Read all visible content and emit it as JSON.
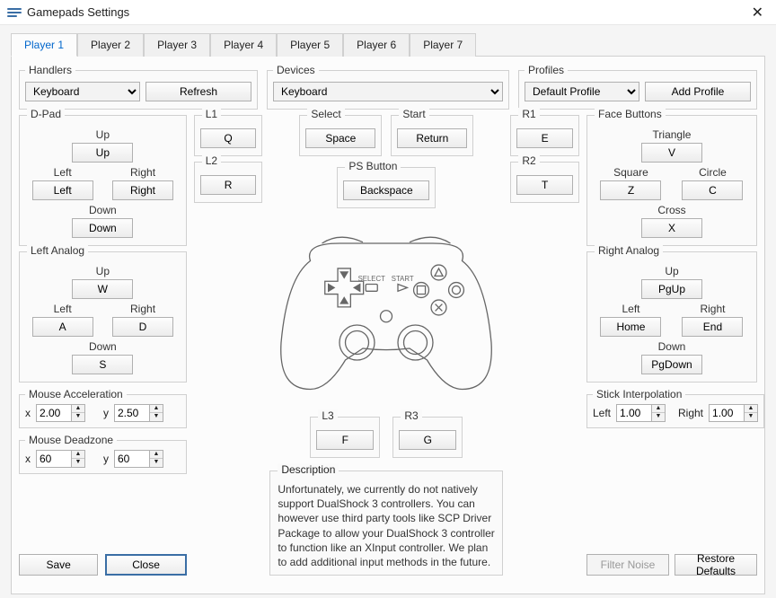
{
  "window": {
    "title": "Gamepads Settings"
  },
  "tabs": [
    "Player 1",
    "Player 2",
    "Player 3",
    "Player 4",
    "Player 5",
    "Player 6",
    "Player 7"
  ],
  "active_tab": 0,
  "handlers": {
    "legend": "Handlers",
    "selected": "Keyboard",
    "refresh": "Refresh"
  },
  "devices": {
    "legend": "Devices",
    "selected": "Keyboard"
  },
  "profiles": {
    "legend": "Profiles",
    "selected": "Default Profile",
    "add": "Add Profile"
  },
  "dpad": {
    "legend": "D-Pad",
    "up_lbl": "Up",
    "up": "Up",
    "left_lbl": "Left",
    "left": "Left",
    "right_lbl": "Right",
    "right": "Right",
    "down_lbl": "Down",
    "down": "Down"
  },
  "lanalog": {
    "legend": "Left Analog",
    "up_lbl": "Up",
    "up": "W",
    "left_lbl": "Left",
    "left": "A",
    "right_lbl": "Right",
    "right": "D",
    "down_lbl": "Down",
    "down": "S"
  },
  "ranalog": {
    "legend": "Right Analog",
    "up_lbl": "Up",
    "up": "PgUp",
    "left_lbl": "Left",
    "left": "Home",
    "right_lbl": "Right",
    "right": "End",
    "down_lbl": "Down",
    "down": "PgDown"
  },
  "l1": {
    "legend": "L1",
    "val": "Q"
  },
  "l2": {
    "legend": "L2",
    "val": "R"
  },
  "r1": {
    "legend": "R1",
    "val": "E"
  },
  "r2": {
    "legend": "R2",
    "val": "T"
  },
  "select": {
    "legend": "Select",
    "val": "Space"
  },
  "start": {
    "legend": "Start",
    "val": "Return"
  },
  "ps": {
    "legend": "PS Button",
    "val": "Backspace"
  },
  "l3": {
    "legend": "L3",
    "val": "F"
  },
  "r3": {
    "legend": "R3",
    "val": "G"
  },
  "face": {
    "legend": "Face Buttons",
    "tri_lbl": "Triangle",
    "tri": "V",
    "sq_lbl": "Square",
    "sq": "Z",
    "ci_lbl": "Circle",
    "ci": "C",
    "cr_lbl": "Cross",
    "cr": "X"
  },
  "maccel": {
    "legend": "Mouse Acceleration",
    "x_lbl": "x",
    "x": "2.00",
    "y_lbl": "y",
    "y": "2.50"
  },
  "mdead": {
    "legend": "Mouse Deadzone",
    "x_lbl": "x",
    "x": "60",
    "y_lbl": "y",
    "y": "60"
  },
  "interp": {
    "legend": "Stick Interpolation",
    "left_lbl": "Left",
    "left": "1.00",
    "right_lbl": "Right",
    "right": "1.00"
  },
  "desc_legend": "Description",
  "desc": "Unfortunately, we currently do not natively support DualShock 3 controllers. You can however use third party tools like SCP Driver Package to allow your DualShock 3 controller to function like an XInput controller. We plan to add additional input methods in the future.",
  "save": "Save",
  "close": "Close",
  "filter": "Filter Noise",
  "restore": "Restore Defaults",
  "ctrl": {
    "select": "SELECT",
    "start": "START"
  }
}
